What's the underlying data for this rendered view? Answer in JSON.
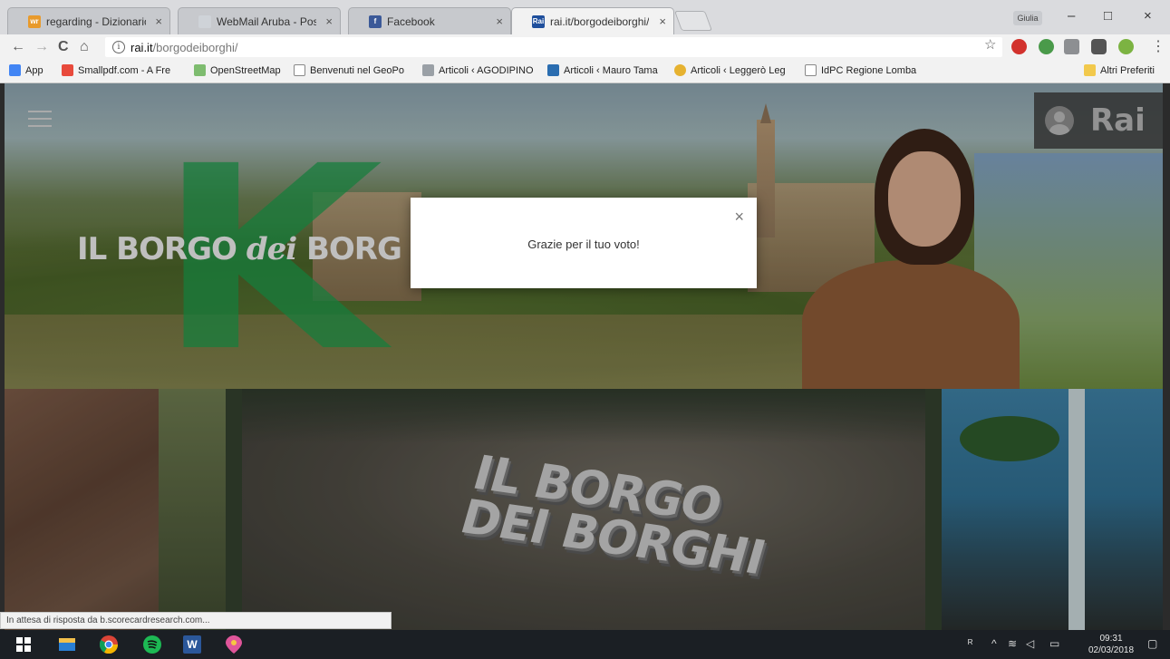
{
  "browser": {
    "tabs": [
      {
        "label": "regarding - Dizionario in",
        "favicon_text": "wr",
        "favicon_color": "#e89a2c",
        "active": false
      },
      {
        "label": "WebMail Aruba - Posta",
        "favicon_text": "",
        "favicon_color": "#cfd3d8",
        "active": false
      },
      {
        "label": "Facebook",
        "favicon_text": "f",
        "favicon_color": "#3b5998",
        "active": false
      },
      {
        "label": "rai.it/borgodeiborghi/",
        "favicon_text": "Rai",
        "favicon_color": "#1f4f9c",
        "active": true
      }
    ],
    "tab_close_glyph": "×",
    "profile_label": "Giulia",
    "window_controls": {
      "minimize": "–",
      "maximize": "□",
      "close": "×"
    },
    "nav": {
      "back": "←",
      "forward": "→",
      "reload": "C",
      "home": "⌂"
    },
    "address": {
      "info_glyph": "i",
      "host": "rai.it",
      "path": "/borgodeiborghi/"
    },
    "star_glyph": "☆",
    "menu_glyph": "⋮",
    "bookmarks": [
      {
        "label": "App",
        "icon_color": "#4285f4"
      },
      {
        "label": "Smallpdf.com - A Fre",
        "icon_color": "#e84a3c"
      },
      {
        "label": "OpenStreetMap",
        "icon_color": "#7ebc6f"
      },
      {
        "label": "Benvenuti nel GeoPo",
        "icon_color": "#ffffff"
      },
      {
        "label": "Articoli ‹ AGODIPINO",
        "icon_color": "#9aa0a6"
      },
      {
        "label": "Articoli ‹ Mauro Tama",
        "icon_color": "#2a6db0"
      },
      {
        "label": "Articoli ‹ Leggerò Leg",
        "icon_color": "#e6b230"
      },
      {
        "label": "IdPC Regione Lomba",
        "icon_color": "#ffffff"
      }
    ],
    "other_bookmarks": "Altri Preferiti"
  },
  "page": {
    "hero_title_a": "IL BORGO ",
    "hero_title_dei": "dei",
    "hero_title_b": " BORG",
    "big_letter": "K",
    "rai_logo": "Rai",
    "logo3d_line1": "IL BORGO",
    "logo3d_line2": "DEI BORGHI",
    "accent_green": "#1a9a4a"
  },
  "modal": {
    "message": "Grazie per il tuo voto!",
    "close_glyph": "×"
  },
  "status": "In attesa di risposta da b.scorecardresearch.com...",
  "taskbar": {
    "time": "09:31",
    "date": "02/03/2018",
    "word_label": "W"
  }
}
